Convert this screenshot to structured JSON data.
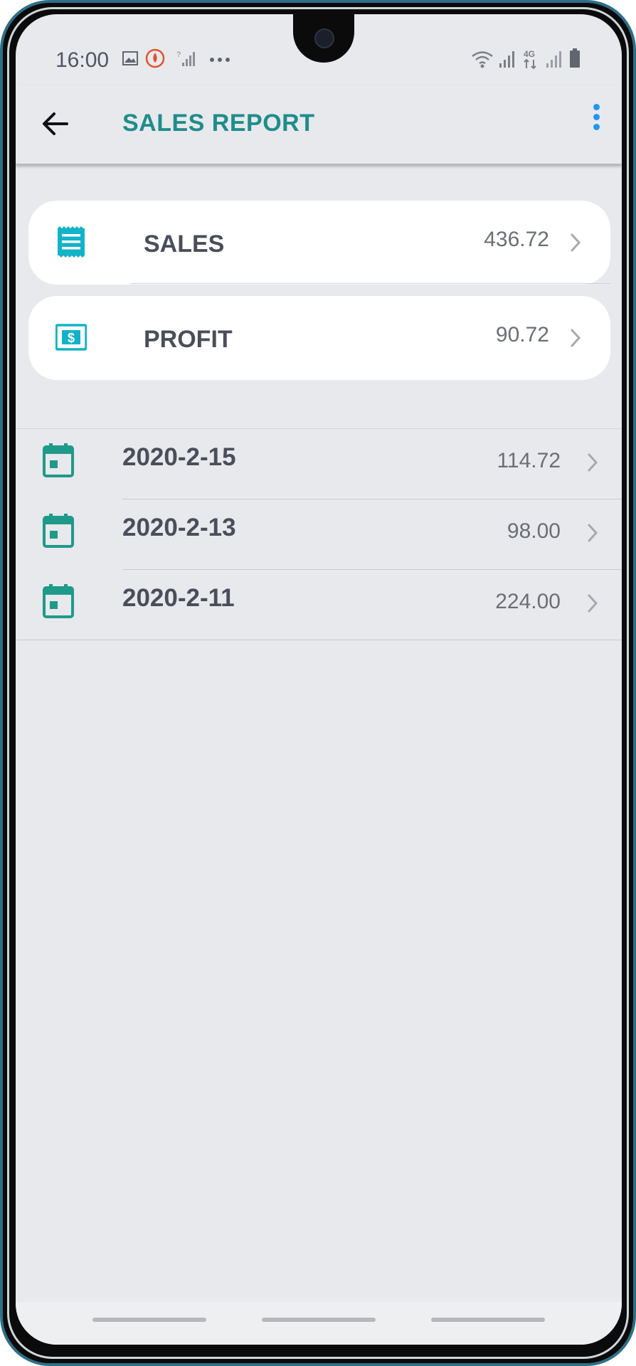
{
  "status_bar": {
    "time": "16:00",
    "left_icons": [
      "image-icon",
      "notification-icon",
      "signal-icon",
      "more-dots-icon"
    ],
    "right_icons": [
      "wifi-icon",
      "signal-icon",
      "lte-4g-icon",
      "signal-icon",
      "battery-icon"
    ]
  },
  "app_bar": {
    "title": "SALES REPORT",
    "accent_color": "#1f8d8a",
    "menu_color": "#2196f3"
  },
  "summary": [
    {
      "label": "SALES",
      "value": "436.72",
      "icon": "receipt-icon"
    },
    {
      "label": "PROFIT",
      "value": "90.72",
      "icon": "dollar-bill-icon"
    }
  ],
  "daily": [
    {
      "date": "2020-2-15",
      "value": "114.72",
      "icon": "calendar-icon"
    },
    {
      "date": "2020-2-13",
      "value": "98.00",
      "icon": "calendar-icon"
    },
    {
      "date": "2020-2-11",
      "value": "224.00",
      "icon": "calendar-icon"
    }
  ],
  "colors": {
    "icon_cyan": "#12b3c8",
    "icon_teal": "#1f9a8a",
    "background": "#e8e9ed"
  }
}
